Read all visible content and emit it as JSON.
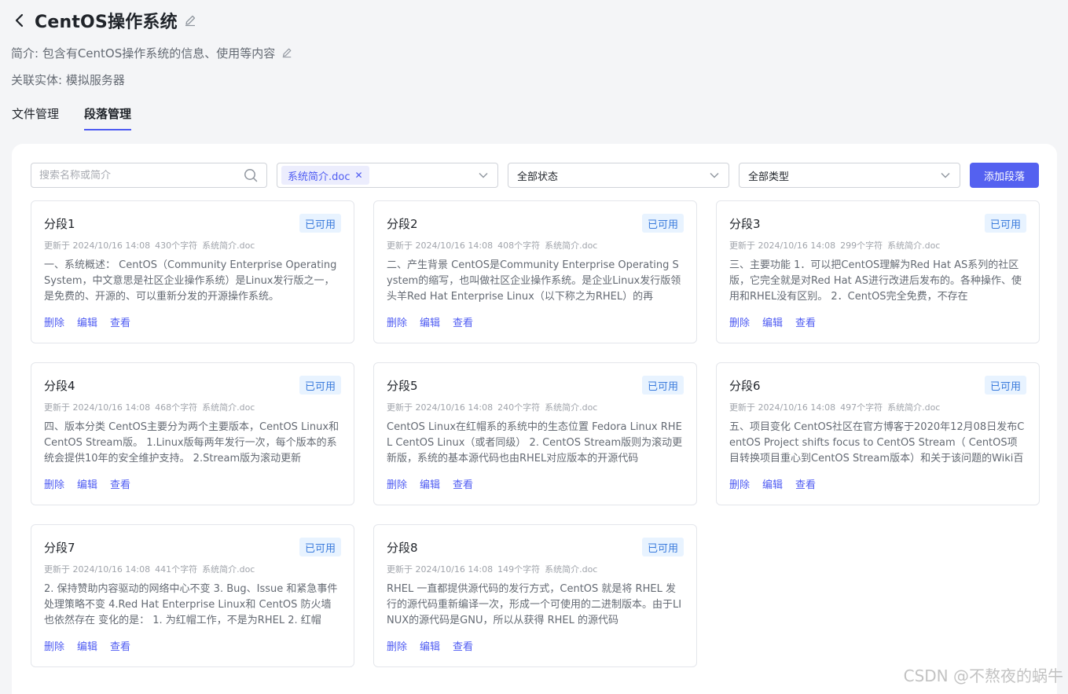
{
  "header": {
    "title": "CentOS操作系统",
    "description": "简介: 包含有CentOS操作系统的信息、使用等内容",
    "related_entity": "关联实体: 模拟服务器"
  },
  "tabs": [
    {
      "label": "文件管理",
      "active": false
    },
    {
      "label": "段落管理",
      "active": true
    }
  ],
  "filters": {
    "search_placeholder": "搜索名称或简介",
    "file_tag": "系统简介.doc",
    "status_label": "全部状态",
    "type_label": "全部类型",
    "add_button": "添加段落"
  },
  "cards": [
    {
      "title": "分段1",
      "status": "已可用",
      "updated": "更新于 2024/10/16 14:08",
      "chars": "430个字符",
      "file": "系统简介.doc",
      "content": "一、系统概述： CentOS（Community Enterprise Operating System，中文意思是社区企业操作系统）是Linux发行版之一，是免费的、开源的、可以重新分发的开源操作系统。"
    },
    {
      "title": "分段2",
      "status": "已可用",
      "updated": "更新于 2024/10/16 14:08",
      "chars": "408个字符",
      "file": "系统简介.doc",
      "content": "二、产生背景 CentOS是Community Enterprise Operating System的缩写，也叫做社区企业操作系统。是企业Linux发行版领头羊Red Hat Enterprise Linux（以下称之为RHEL）的再"
    },
    {
      "title": "分段3",
      "status": "已可用",
      "updated": "更新于 2024/10/16 14:08",
      "chars": "299个字符",
      "file": "系统简介.doc",
      "content": "三、主要功能 1．可以把CentOS理解为Red Hat AS系列的社区版，它完全就是对Red Hat AS进行改进后发布的。各种操作、使用和RHEL没有区别。 2．CentOS完全免费，不存在"
    },
    {
      "title": "分段4",
      "status": "已可用",
      "updated": "更新于 2024/10/16 14:08",
      "chars": "468个字符",
      "file": "系统简介.doc",
      "content": "四、版本分类 CentOS主要分为两个主要版本，CentOS Linux和CentOS Stream版。 1.Linux版每两年发行一次，每个版本的系统会提供10年的安全维护支持。 2.Stream版为滚动更新"
    },
    {
      "title": "分段5",
      "status": "已可用",
      "updated": "更新于 2024/10/16 14:08",
      "chars": "240个字符",
      "file": "系统简介.doc",
      "content": "CentOS Linux在红帽系的系统中的生态位置 Fedora Linux RHEL CentOS Linux（或者同级） 2. CentOS Stream版则为滚动更新版，系统的基本源代码也由RHEL对应版本的开源代码"
    },
    {
      "title": "分段6",
      "status": "已可用",
      "updated": "更新于 2024/10/16 14:08",
      "chars": "497个字符",
      "file": "系统简介.doc",
      "content": "五、项目变化 CentOS社区在官方博客于2020年12月08日发布CentOS Project shifts focus to CentOS Stream（ CentOS项目转换项目重心到CentOS Stream版本）和关于该问题的Wiki百"
    },
    {
      "title": "分段7",
      "status": "已可用",
      "updated": "更新于 2024/10/16 14:08",
      "chars": "441个字符",
      "file": "系统简介.doc",
      "content": "2. 保持赞助内容驱动的网络中心不变 3. Bug、Issue 和紧急事件处理策略不变 4.Red Hat Enterprise Linux和 CentOS 防火墙也依然存在 变化的是： 1. 为红帽工作，不是为RHEL 2. 红帽"
    },
    {
      "title": "分段8",
      "status": "已可用",
      "updated": "更新于 2024/10/16 14:08",
      "chars": "149个字符",
      "file": "系统简介.doc",
      "content": "RHEL 一直都提供源代码的发行方式，CentOS 就是将 RHEL 发行的源代码重新编译一次，形成一个可使用的二进制版本。由于LINUX的源代码是GNU，所以从获得 RHEL 的源代码"
    }
  ],
  "card_actions": {
    "delete": "删除",
    "edit": "编辑",
    "view": "查看"
  },
  "watermark": "CSDN @不熬夜的蜗牛",
  "colors": {
    "accent": "#5461f0",
    "badge_bg": "#e8f3ff",
    "badge_text": "#3a7bdc"
  }
}
